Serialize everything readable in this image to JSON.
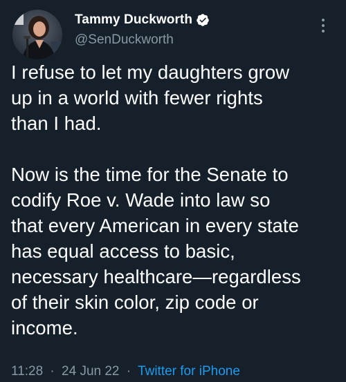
{
  "author": {
    "display_name": "Tammy Duckworth",
    "handle": "@SenDuckworth",
    "verified_icon": "verified-badge-icon",
    "avatar_icon": "profile-photo"
  },
  "tweet": {
    "paragraph_1": "I refuse to let my daughters grow\nup in a world with fewer rights\nthan I had.",
    "paragraph_2": "Now is the time for the Senate to\ncodify Roe v. Wade into law so\nthat every American in every state\nhas equal access to basic,\nnecessary healthcare—regardless\nof their skin color, zip code or\nincome."
  },
  "meta": {
    "time": "11:28",
    "separator": "·",
    "date": "24 Jun 22",
    "source": "Twitter for iPhone"
  },
  "colors": {
    "background": "#15202b",
    "text_primary": "#ffffff",
    "text_secondary": "#8b98a5",
    "accent": "#1d9bf0"
  },
  "icons": {
    "more": "more-options-icon"
  }
}
